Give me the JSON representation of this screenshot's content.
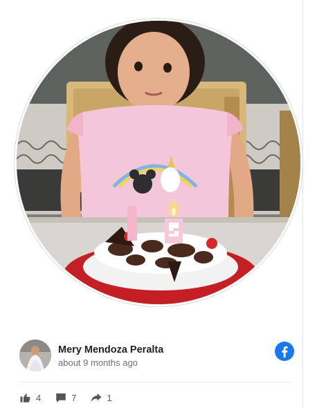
{
  "post": {
    "photo_icon": "birthday-photo",
    "author": {
      "name": "Mery Mendoza Peralta",
      "time": "about 9 months ago",
      "avatar_icon": "profile-photo"
    },
    "source_icon": "facebook-icon",
    "colors": {
      "facebook": "#1877f2",
      "action_icon": "#555555",
      "meta_text": "#6f6f6f"
    }
  },
  "reactions": {
    "likes": "4",
    "comments": "7",
    "shares": "1"
  }
}
